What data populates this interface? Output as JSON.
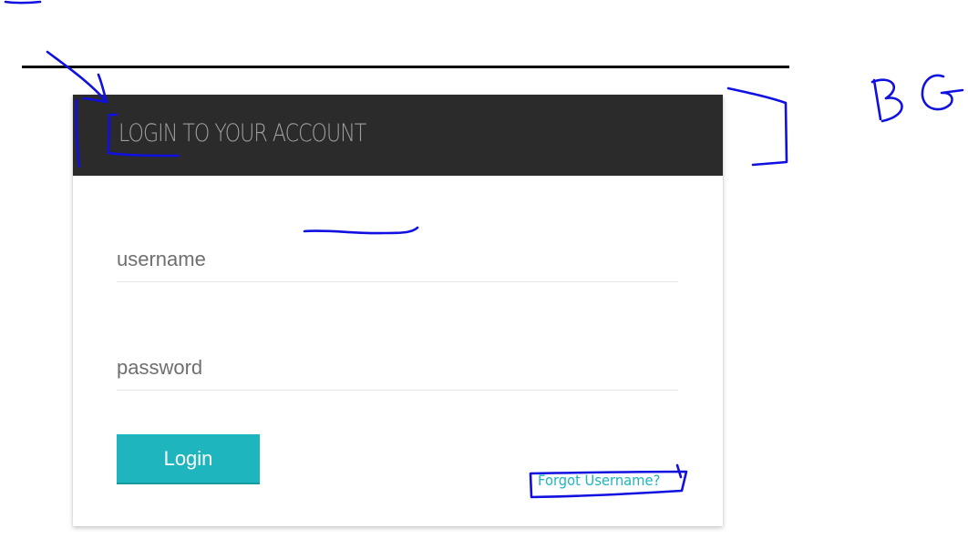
{
  "login_card": {
    "title": "LOGIN TO YOUR ACCOUNT",
    "username_placeholder": "username",
    "password_placeholder": "password",
    "login_label": "Login",
    "forgot_link": "Forgot Username?"
  },
  "annotations": {
    "label": "BG",
    "ink_color": "#1010e0"
  },
  "colors": {
    "header_background": "#2b2b2b",
    "header_text": "#9e9e9e",
    "accent": "#1fb5bf",
    "rule": "#000000"
  }
}
